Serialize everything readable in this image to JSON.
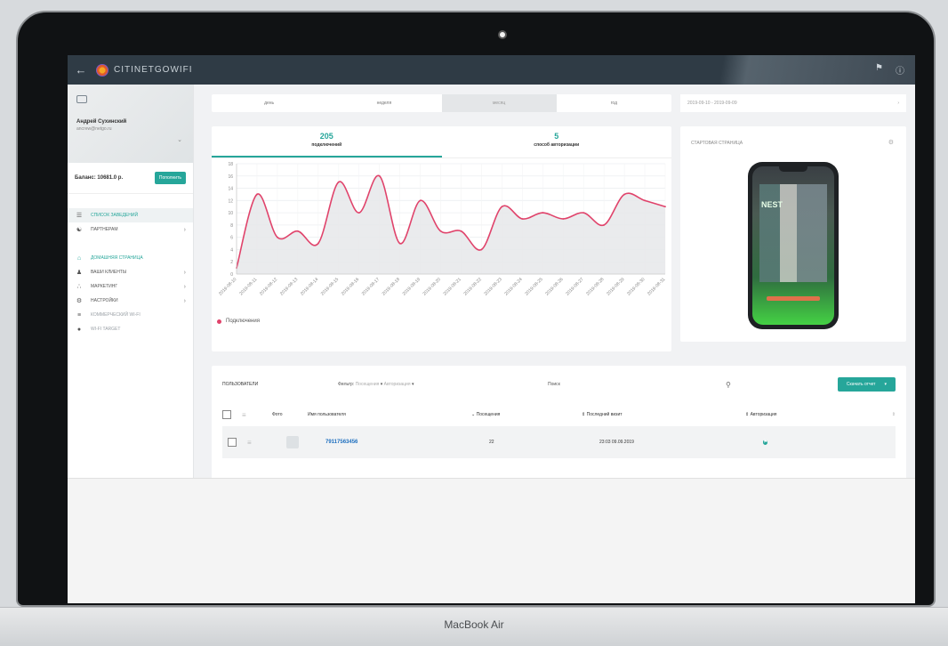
{
  "device": {
    "brand": "MacBook Air"
  },
  "topbar": {
    "back_icon": "arrow-left-icon",
    "logo_text": "CITINETGOWIFI",
    "right_icons": [
      "bell-icon",
      "help-icon"
    ]
  },
  "sidebar": {
    "profile": {
      "name": "Андрей Сухинский",
      "email": "ancrew@netgo.ru"
    },
    "balance_label": "Баланс: 10681.0 р.",
    "topup_label": "Пополнить",
    "items": [
      {
        "label": "СПИСОК ЗАВЕДЕНИЙ",
        "icon": "list-icon"
      },
      {
        "label": "ПАРТНЕРАМ",
        "icon": "handshake-icon"
      },
      {
        "label": "ДОМАШНЯЯ СТРАНИЦА",
        "icon": "home-icon"
      },
      {
        "label": "ВАШИ КЛИЕНТЫ",
        "icon": "person-icon"
      },
      {
        "label": "МАРКЕТИНГ",
        "icon": "network-icon"
      },
      {
        "label": "НАСТРОЙКИ",
        "icon": "gear-icon"
      },
      {
        "label": "КОММЕРЧЕСКИЙ WI-FI",
        "icon": "wifi-icon"
      },
      {
        "label": "WI-FI TARGET",
        "icon": "pin-icon"
      }
    ]
  },
  "period": {
    "tabs": [
      "день",
      "неделя",
      "месяц",
      "год"
    ],
    "selected": "месяц",
    "date_range": "2019-09-10 - 2019-09-09"
  },
  "stats": [
    {
      "value": "205",
      "label": "подключений"
    },
    {
      "value": "5",
      "label": "способ авторизации"
    }
  ],
  "chart_data": {
    "type": "area",
    "x": [
      "2019-08-10",
      "2019-08-11",
      "2019-08-12",
      "2019-08-13",
      "2019-08-14",
      "2019-08-15",
      "2019-08-16",
      "2019-08-17",
      "2019-08-18",
      "2019-08-19",
      "2019-08-20",
      "2019-08-21",
      "2019-08-22",
      "2019-08-23",
      "2019-08-24",
      "2019-08-25",
      "2019-08-26",
      "2019-08-27",
      "2019-08-28",
      "2019-08-29",
      "2019-08-30",
      "2019-08-31"
    ],
    "series": [
      {
        "name": "Подключения",
        "values": [
          1,
          13,
          6,
          7,
          5,
          15,
          10,
          16,
          5,
          12,
          7,
          7,
          4,
          11,
          9,
          10,
          9,
          10,
          8,
          13,
          12,
          11
        ]
      }
    ],
    "ylim": [
      0,
      18
    ],
    "yticks": [
      0,
      2,
      4,
      6,
      8,
      10,
      12,
      14,
      16,
      18
    ],
    "grid": true,
    "legend": "bottom-left",
    "color": "#e0436b"
  },
  "landing": {
    "title": "СТАРТОВАЯ СТРАНИЦА",
    "sign_text": "NEST"
  },
  "users": {
    "title": "ПОЛЬЗОВАТЕЛИ",
    "filter_label": "Фильтр:",
    "filter_options": [
      "Посещения",
      "Авторизация"
    ],
    "search_label": "Поиск",
    "download_label": "Скачать отчет",
    "columns": [
      "Фото",
      "Имя пользователя",
      "Посещения",
      "Последний визит",
      "Авторизация"
    ],
    "rows": [
      {
        "user": "79117563456",
        "visits": "22",
        "last_visit": "23:03 09.09.2019"
      }
    ]
  }
}
